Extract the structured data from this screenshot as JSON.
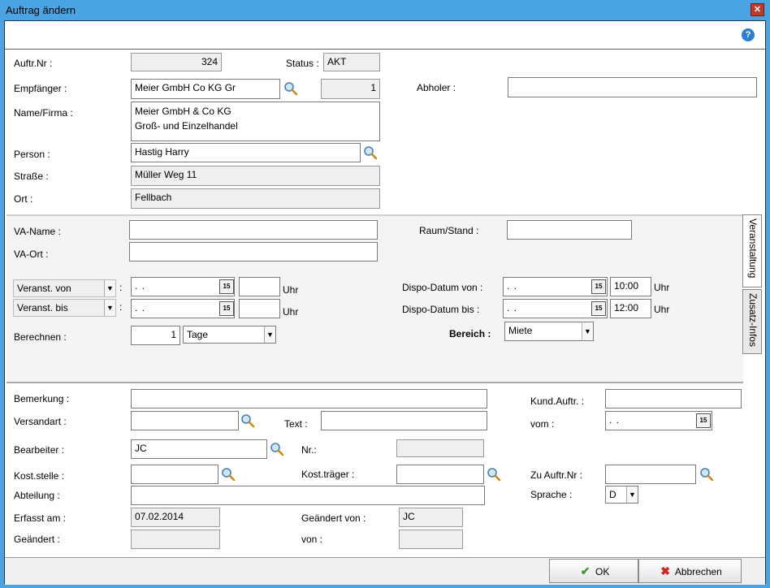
{
  "window": {
    "title": "Auftrag ändern",
    "close_label": "✕",
    "help_label": "?"
  },
  "section1": {
    "auftr_nr_label": "Auftr.Nr :",
    "auftr_nr_value": "324",
    "status_label": "Status :",
    "status_value": "AKT",
    "empfaenger_label": "Empfänger :",
    "empfaenger_value": "Meier GmbH  Co KG Gr",
    "empfaenger_num": "1",
    "abholer_label": "Abholer :",
    "abholer_value": "",
    "name_label": "Name/Firma :",
    "name_value": "Meier GmbH & Co KG\nGroß- und Einzelhandel",
    "person_label": "Person :",
    "person_value": "Hastig Harry",
    "strasse_label": "Straße :",
    "strasse_value": "Müller Weg 11",
    "ort_label": "Ort :",
    "ort_value": "Fellbach"
  },
  "section2": {
    "va_name_label": "VA-Name :",
    "va_name_value": "",
    "va_ort_label": "VA-Ort :",
    "va_ort_value": "",
    "raum_label": "Raum/Stand :",
    "raum_value": "",
    "veranst_von_label": "Veranst. von",
    "veranst_bis_label": "Veranst. bis",
    "colon": ":",
    "date_placeholder": " .  .",
    "uhr": "Uhr",
    "dispo_von_label": "Dispo-Datum von :",
    "dispo_von_time": "10:00",
    "dispo_bis_label": "Dispo-Datum bis :",
    "dispo_bis_time": "12:00",
    "berechnen_label": "Berechnen :",
    "berechnen_value": "1",
    "berechnen_unit": "Tage",
    "bereich_label": "Bereich :",
    "bereich_value": "Miete",
    "tab_veranstaltung": "Veranstaltung",
    "tab_zusatz": "Zusatz-Infos",
    "cal_label": "15"
  },
  "section3": {
    "bemerkung_label": "Bemerkung :",
    "bemerkung_value": "",
    "kund_auftr_label": "Kund.Auftr. :",
    "kund_auftr_value": "",
    "versandart_label": "Versandart :",
    "versandart_value": "",
    "text_label": "Text :",
    "text_value": "",
    "vom_label": "vom :",
    "vom_value": " .  .",
    "bearbeiter_label": "Bearbeiter :",
    "bearbeiter_value": "JC",
    "nr_label": "Nr.:",
    "nr_value": "",
    "kost_stelle_label": "Kost.stelle :",
    "kost_stelle_value": "",
    "kost_traeger_label": "Kost.träger :",
    "kost_traeger_value": "",
    "zu_auftr_label": "Zu Auftr.Nr :",
    "zu_auftr_value": "",
    "abteilung_label": "Abteilung :",
    "abteilung_value": "",
    "sprache_label": "Sprache :",
    "sprache_value": "D",
    "erfasst_label": "Erfasst am :",
    "erfasst_value": "07.02.2014",
    "geaendert_von_label": "Geändert von :",
    "geaendert_von_value": "JC",
    "geaendert_label": "Geändert :",
    "geaendert_value": "",
    "von_label": "von :",
    "von_value": ""
  },
  "footer": {
    "ok_label": "OK",
    "cancel_label": "Abbrechen"
  }
}
